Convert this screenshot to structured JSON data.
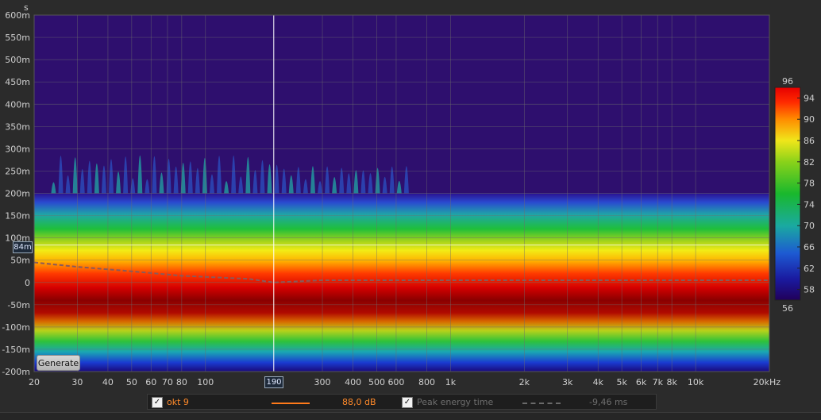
{
  "chart_data": {
    "type": "heatmap",
    "title": "",
    "y_unit_label": "s",
    "xlabel": "",
    "ylabel": "",
    "x_scale": "log",
    "xlim": [
      20,
      20000
    ],
    "ylim": [
      -0.2,
      0.6
    ],
    "x_ticks": [
      {
        "v": 20,
        "label": "20"
      },
      {
        "v": 30,
        "label": "30"
      },
      {
        "v": 40,
        "label": "40"
      },
      {
        "v": 50,
        "label": "50"
      },
      {
        "v": 60,
        "label": "60"
      },
      {
        "v": 70,
        "label": "70"
      },
      {
        "v": 80,
        "label": "80"
      },
      {
        "v": 100,
        "label": "100"
      },
      {
        "v": 300,
        "label": "300"
      },
      {
        "v": 400,
        "label": "400"
      },
      {
        "v": 500,
        "label": "500"
      },
      {
        "v": 600,
        "label": "600"
      },
      {
        "v": 800,
        "label": "800"
      },
      {
        "v": 1000,
        "label": "1k"
      },
      {
        "v": 2000,
        "label": "2k"
      },
      {
        "v": 3000,
        "label": "3k"
      },
      {
        "v": 4000,
        "label": "4k"
      },
      {
        "v": 5000,
        "label": "5k"
      },
      {
        "v": 6000,
        "label": "6k"
      },
      {
        "v": 7000,
        "label": "7k"
      },
      {
        "v": 8000,
        "label": "8k"
      },
      {
        "v": 10000,
        "label": "10k"
      },
      {
        "v": 20000,
        "label": "20kHz"
      }
    ],
    "y_ticks": [
      {
        "v": 0.6,
        "label": "600m"
      },
      {
        "v": 0.55,
        "label": "550m"
      },
      {
        "v": 0.5,
        "label": "500m"
      },
      {
        "v": 0.45,
        "label": "450m"
      },
      {
        "v": 0.4,
        "label": "400m"
      },
      {
        "v": 0.35,
        "label": "350m"
      },
      {
        "v": 0.3,
        "label": "300m"
      },
      {
        "v": 0.25,
        "label": "250m"
      },
      {
        "v": 0.2,
        "label": "200m"
      },
      {
        "v": 0.15,
        "label": "150m"
      },
      {
        "v": 0.1,
        "label": "100m"
      },
      {
        "v": 0.05,
        "label": "50m"
      },
      {
        "v": 0,
        "label": "0"
      },
      {
        "v": -0.05,
        "label": "-50m"
      },
      {
        "v": -0.1,
        "label": "-100m"
      },
      {
        "v": -0.15,
        "label": "-150m"
      },
      {
        "v": -0.2,
        "label": "-200m"
      }
    ],
    "colorbar": {
      "min_label": "56",
      "max_label": "96",
      "range": [
        56,
        96
      ],
      "ticks": [
        "94",
        "90",
        "86",
        "82",
        "78",
        "74",
        "70",
        "66",
        "62",
        "58"
      ]
    },
    "cursor": {
      "freq_hz": 190,
      "freq_label": "190",
      "time_s": 0.084,
      "time_label": "84m"
    },
    "energy_profile": {
      "description_values": "decay top edge (s) vs frequency (Hz)",
      "freq": [
        20,
        40,
        100,
        190,
        300,
        500,
        1000,
        2000,
        5000,
        10000,
        20000
      ],
      "top_s": [
        0.29,
        0.27,
        0.24,
        0.22,
        0.21,
        0.205,
        0.2,
        0.2,
        0.2,
        0.2,
        0.2
      ]
    },
    "peak_energy_time": {
      "freq": [
        20,
        30,
        50,
        80,
        150,
        190,
        300,
        1000,
        20000
      ],
      "t": [
        0.045,
        0.035,
        0.025,
        0.015,
        0.008,
        0.0,
        0.005,
        0.005,
        0.005
      ]
    },
    "grid": true,
    "legend_position": "bottom-center"
  },
  "controls": {
    "generate_label": "Generate"
  },
  "legend": {
    "series1_name": "okt 9",
    "series1_value": "88,0 dB",
    "series1_color": "#ff7a1a",
    "series2_name": "Peak energy time",
    "series2_value": "-9,46 ms",
    "series2_color": "#6a6a6a"
  },
  "colors": {
    "background": "#2b2b2b",
    "plot_bg": "#2e0f6e",
    "grid": "#6d6d6d"
  }
}
